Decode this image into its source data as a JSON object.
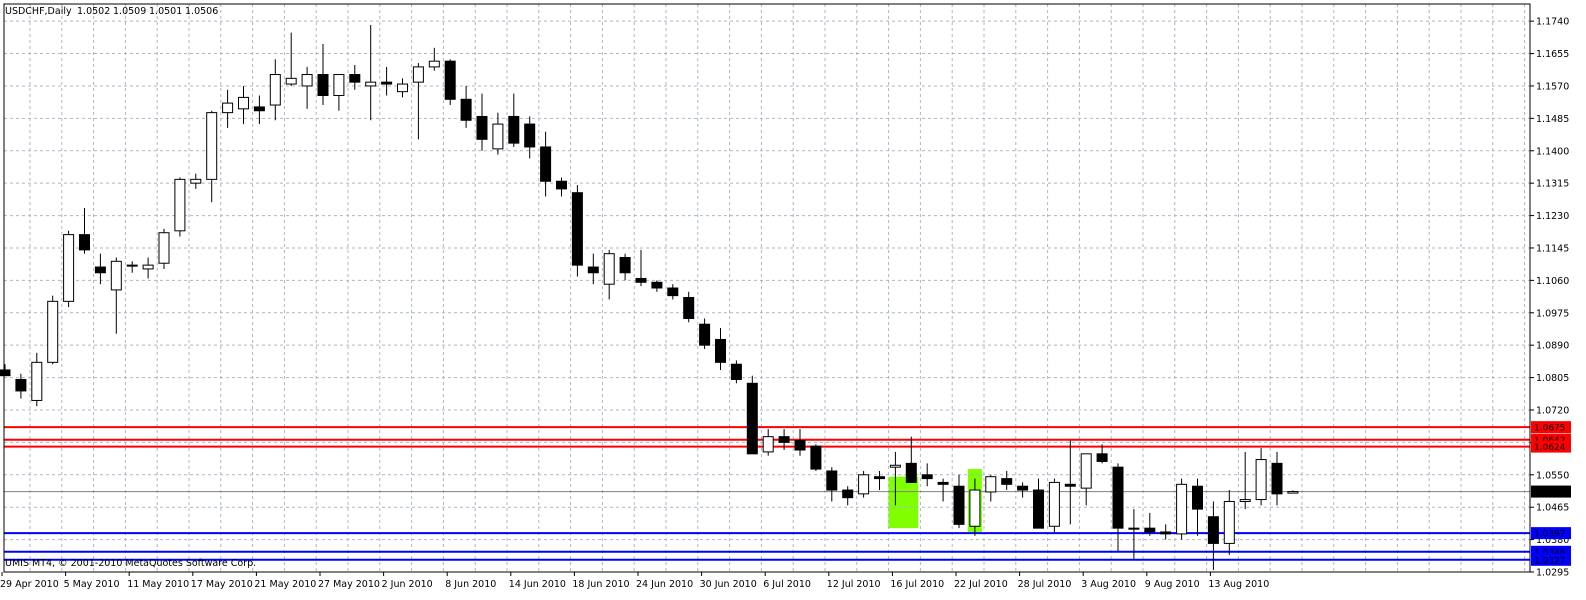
{
  "header": {
    "symbol_line": "USDCHF,Daily",
    "ohlc": [
      "1.0502",
      "1.0509",
      "1.0501",
      "1.0506"
    ]
  },
  "footer": {
    "copyright": "UMIS MT4, © 2001-2010 MetaQuotes Software Corp."
  },
  "colors": {
    "background": "#ffffff",
    "grid": "#a9b7c8",
    "bull_body": "#ffffff",
    "bear_body": "#000000",
    "resistance": "#ff0000",
    "support": "#0000ff",
    "highlight": "#7fff00",
    "bid_line": "#808080"
  },
  "chart_data": {
    "type": "candlestick",
    "symbol": "USDCHF",
    "timeframe": "Daily",
    "grid": true,
    "ylim": [
      1.0295,
      1.1785
    ],
    "y_ticks": [
      "1.1740",
      "1.1655",
      "1.1570",
      "1.1485",
      "1.1400",
      "1.1315",
      "1.1230",
      "1.1145",
      "1.1060",
      "1.0975",
      "1.0890",
      "1.0805",
      "1.0720",
      "1.0635",
      "1.0550",
      "1.0465",
      "1.0380",
      "1.0295"
    ],
    "x_ticks": [
      {
        "label": "29 Apr 2010",
        "index": 0
      },
      {
        "label": "5 May 2010",
        "index": 4
      },
      {
        "label": "11 May 2010",
        "index": 8
      },
      {
        "label": "17 May 2010",
        "index": 12
      },
      {
        "label": "21 May 2010",
        "index": 16
      },
      {
        "label": "27 May 2010",
        "index": 20
      },
      {
        "label": "2 Jun 2010",
        "index": 24
      },
      {
        "label": "8 Jun 2010",
        "index": 28
      },
      {
        "label": "14 Jun 2010",
        "index": 32
      },
      {
        "label": "18 Jun 2010",
        "index": 36
      },
      {
        "label": "24 Jun 2010",
        "index": 40
      },
      {
        "label": "30 Jun 2010",
        "index": 44
      },
      {
        "label": "6 Jul 2010",
        "index": 48
      },
      {
        "label": "12 Jul 2010",
        "index": 52
      },
      {
        "label": "16 Jul 2010",
        "index": 56
      },
      {
        "label": "22 Jul 2010",
        "index": 60
      },
      {
        "label": "28 Jul 2010",
        "index": 64
      },
      {
        "label": "3 Aug 2010",
        "index": 68
      },
      {
        "label": "9 Aug 2010",
        "index": 72
      },
      {
        "label": "13 Aug 2010",
        "index": 76
      }
    ],
    "candles": [
      [
        1.0825,
        1.084,
        1.081,
        1.081
      ],
      [
        1.08,
        1.0815,
        1.075,
        1.077
      ],
      [
        1.0745,
        1.087,
        1.073,
        1.0845
      ],
      [
        1.0845,
        1.102,
        1.084,
        1.1005
      ],
      [
        1.1005,
        1.119,
        1.099,
        1.118
      ],
      [
        1.118,
        1.125,
        1.113,
        1.114
      ],
      [
        1.1095,
        1.113,
        1.105,
        1.108
      ],
      [
        1.1035,
        1.112,
        1.092,
        1.111
      ],
      [
        1.11,
        1.111,
        1.108,
        1.11
      ],
      [
        1.109,
        1.112,
        1.1065,
        1.11
      ],
      [
        1.1105,
        1.1195,
        1.109,
        1.1185
      ],
      [
        1.119,
        1.133,
        1.1175,
        1.1325
      ],
      [
        1.1315,
        1.134,
        1.13,
        1.1325
      ],
      [
        1.1325,
        1.1505,
        1.1265,
        1.15
      ],
      [
        1.15,
        1.156,
        1.146,
        1.1525
      ],
      [
        1.151,
        1.157,
        1.147,
        1.154
      ],
      [
        1.1515,
        1.1545,
        1.147,
        1.1505
      ],
      [
        1.152,
        1.164,
        1.148,
        1.16
      ],
      [
        1.1575,
        1.171,
        1.157,
        1.159
      ],
      [
        1.157,
        1.162,
        1.151,
        1.16
      ],
      [
        1.16,
        1.168,
        1.152,
        1.1545
      ],
      [
        1.1545,
        1.16,
        1.1505,
        1.16
      ],
      [
        1.16,
        1.1625,
        1.156,
        1.158
      ],
      [
        1.157,
        1.173,
        1.148,
        1.158
      ],
      [
        1.158,
        1.162,
        1.1545,
        1.1575
      ],
      [
        1.1555,
        1.159,
        1.154,
        1.1575
      ],
      [
        1.158,
        1.163,
        1.143,
        1.162
      ],
      [
        1.162,
        1.167,
        1.161,
        1.1635
      ],
      [
        1.1635,
        1.164,
        1.152,
        1.1535
      ],
      [
        1.1535,
        1.157,
        1.146,
        1.148
      ],
      [
        1.149,
        1.155,
        1.14,
        1.143
      ],
      [
        1.1405,
        1.15,
        1.139,
        1.147
      ],
      [
        1.149,
        1.155,
        1.141,
        1.142
      ],
      [
        1.147,
        1.149,
        1.138,
        1.141
      ],
      [
        1.141,
        1.145,
        1.128,
        1.132
      ],
      [
        1.132,
        1.133,
        1.128,
        1.13
      ],
      [
        1.129,
        1.131,
        1.107,
        1.11
      ],
      [
        1.1095,
        1.113,
        1.105,
        1.108
      ],
      [
        1.105,
        1.114,
        1.101,
        1.113
      ],
      [
        1.112,
        1.113,
        1.106,
        1.108
      ],
      [
        1.1065,
        1.114,
        1.1045,
        1.1055
      ],
      [
        1.1055,
        1.106,
        1.103,
        1.104
      ],
      [
        1.104,
        1.105,
        1.101,
        1.102
      ],
      [
        1.1015,
        1.103,
        1.095,
        1.096
      ],
      [
        1.0945,
        1.096,
        1.088,
        1.089
      ],
      [
        1.0905,
        1.0935,
        1.0825,
        1.0845
      ],
      [
        1.084,
        1.085,
        1.079,
        1.08
      ],
      [
        1.079,
        1.081,
        1.064,
        1.0605
      ],
      [
        1.061,
        1.067,
        1.06,
        1.065
      ],
      [
        1.065,
        1.067,
        1.0615,
        1.0635
      ],
      [
        1.064,
        1.067,
        1.06,
        1.0615
      ],
      [
        1.0625,
        1.063,
        1.056,
        1.0565
      ],
      [
        1.056,
        1.057,
        1.048,
        1.051
      ],
      [
        1.051,
        1.052,
        1.047,
        1.049
      ],
      [
        1.05,
        1.056,
        1.049,
        1.055
      ],
      [
        1.0545,
        1.056,
        1.051,
        1.054
      ],
      [
        1.057,
        1.061,
        1.047,
        1.0575
      ],
      [
        1.058,
        1.065,
        1.053,
        1.053
      ],
      [
        1.055,
        1.058,
        1.052,
        1.054
      ],
      [
        1.053,
        1.054,
        1.048,
        1.0525
      ],
      [
        1.052,
        1.055,
        1.041,
        1.042
      ],
      [
        1.0415,
        1.054,
        1.039,
        1.051
      ],
      [
        1.0505,
        1.055,
        1.048,
        1.0545
      ],
      [
        1.054,
        1.056,
        1.051,
        1.0525
      ],
      [
        1.052,
        1.053,
        1.049,
        1.051
      ],
      [
        1.051,
        1.054,
        1.043,
        1.041
      ],
      [
        1.0415,
        1.054,
        1.04,
        1.053
      ],
      [
        1.0525,
        1.064,
        1.042,
        1.052
      ],
      [
        1.0515,
        1.0605,
        1.047,
        1.0605
      ],
      [
        1.0605,
        1.063,
        1.058,
        1.0585
      ],
      [
        1.057,
        1.058,
        1.035,
        1.041
      ],
      [
        1.041,
        1.046,
        1.033,
        1.041
      ],
      [
        1.041,
        1.045,
        1.039,
        1.04
      ],
      [
        1.04,
        1.042,
        1.038,
        1.0395
      ],
      [
        1.0395,
        1.054,
        1.038,
        1.0525
      ],
      [
        1.052,
        1.054,
        1.039,
        1.046
      ],
      [
        1.044,
        1.048,
        1.03,
        1.037
      ],
      [
        1.037,
        1.051,
        1.034,
        1.048
      ],
      [
        1.048,
        1.061,
        1.046,
        1.0485
      ],
      [
        1.0485,
        1.062,
        1.047,
        1.059
      ],
      [
        1.058,
        1.061,
        1.047,
        1.05
      ],
      [
        1.0502,
        1.0509,
        1.0501,
        1.0506
      ]
    ],
    "hlines": [
      {
        "price": 1.0675,
        "label": "1.0675",
        "kind": "resistance"
      },
      {
        "price": 1.0642,
        "label": "1.0642",
        "kind": "resistance"
      },
      {
        "price": 1.0624,
        "label": "1.0624",
        "kind": "resistance"
      },
      {
        "price": 1.0506,
        "label": "1.0506",
        "kind": "bid"
      },
      {
        "price": 1.0397,
        "label": "1.0397",
        "kind": "support"
      },
      {
        "price": 1.0348,
        "label": "1.0348",
        "kind": "support"
      },
      {
        "price": 1.0327,
        "label": "1.0327",
        "kind": "support"
      }
    ],
    "highlights": [
      {
        "from_index": 56,
        "to_index": 57,
        "price_top": 1.0545,
        "price_bottom": 1.041
      },
      {
        "from_index": 61,
        "to_index": 61,
        "price_top": 1.0565,
        "price_bottom": 1.04
      }
    ]
  }
}
